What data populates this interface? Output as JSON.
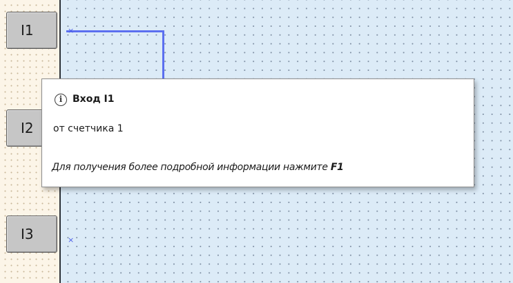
{
  "inputs": [
    {
      "label": "I1"
    },
    {
      "label": "I2"
    },
    {
      "label": "I3"
    }
  ],
  "pin_marker": "×",
  "tooltip": {
    "icon": "info-icon",
    "title": "Вход I1",
    "description": "от счетчика 1",
    "hint_text": "Для получения более подробной информации нажмите",
    "hint_key": "F1"
  },
  "colors": {
    "canvas_bg": "#dcebf7",
    "left_panel_bg": "#fcf5e8",
    "wire": "#5b6ff0",
    "block_fill": "#c6c6c6"
  }
}
